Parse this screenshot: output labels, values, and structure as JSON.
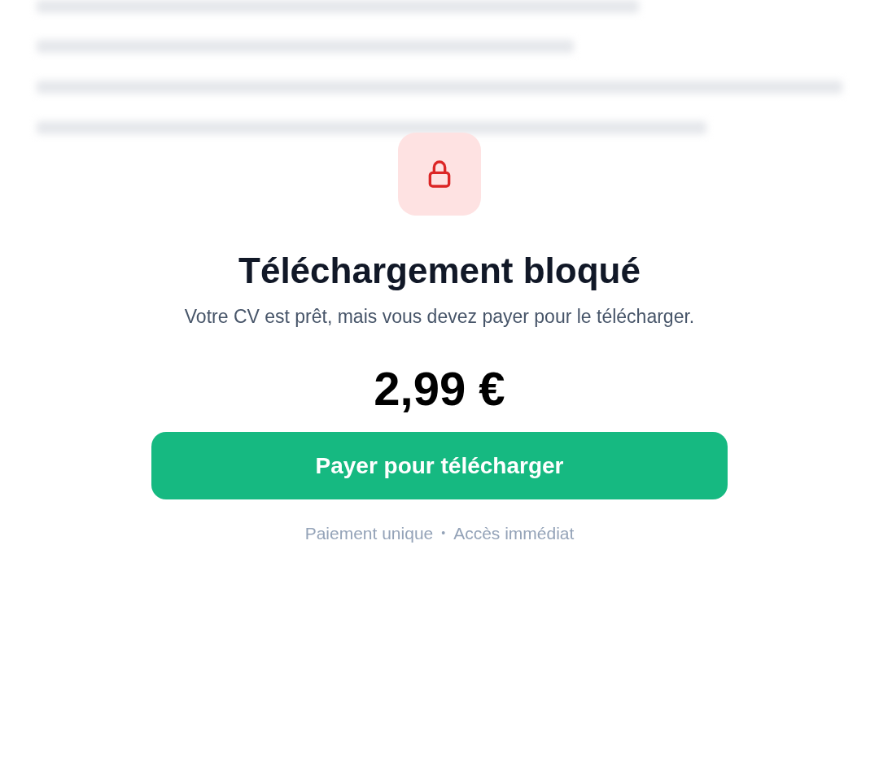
{
  "background": {
    "kind": "blurred-document"
  },
  "title": "Téléchargement bloqué",
  "message": "Votre CV est prêt, mais vous devez payer pour le télécharger.",
  "price": "2,99 €",
  "pay_button": "Payer pour télécharger",
  "footer": {
    "left": "Paiement unique",
    "separator": "•",
    "right": "Accès immédiat"
  }
}
